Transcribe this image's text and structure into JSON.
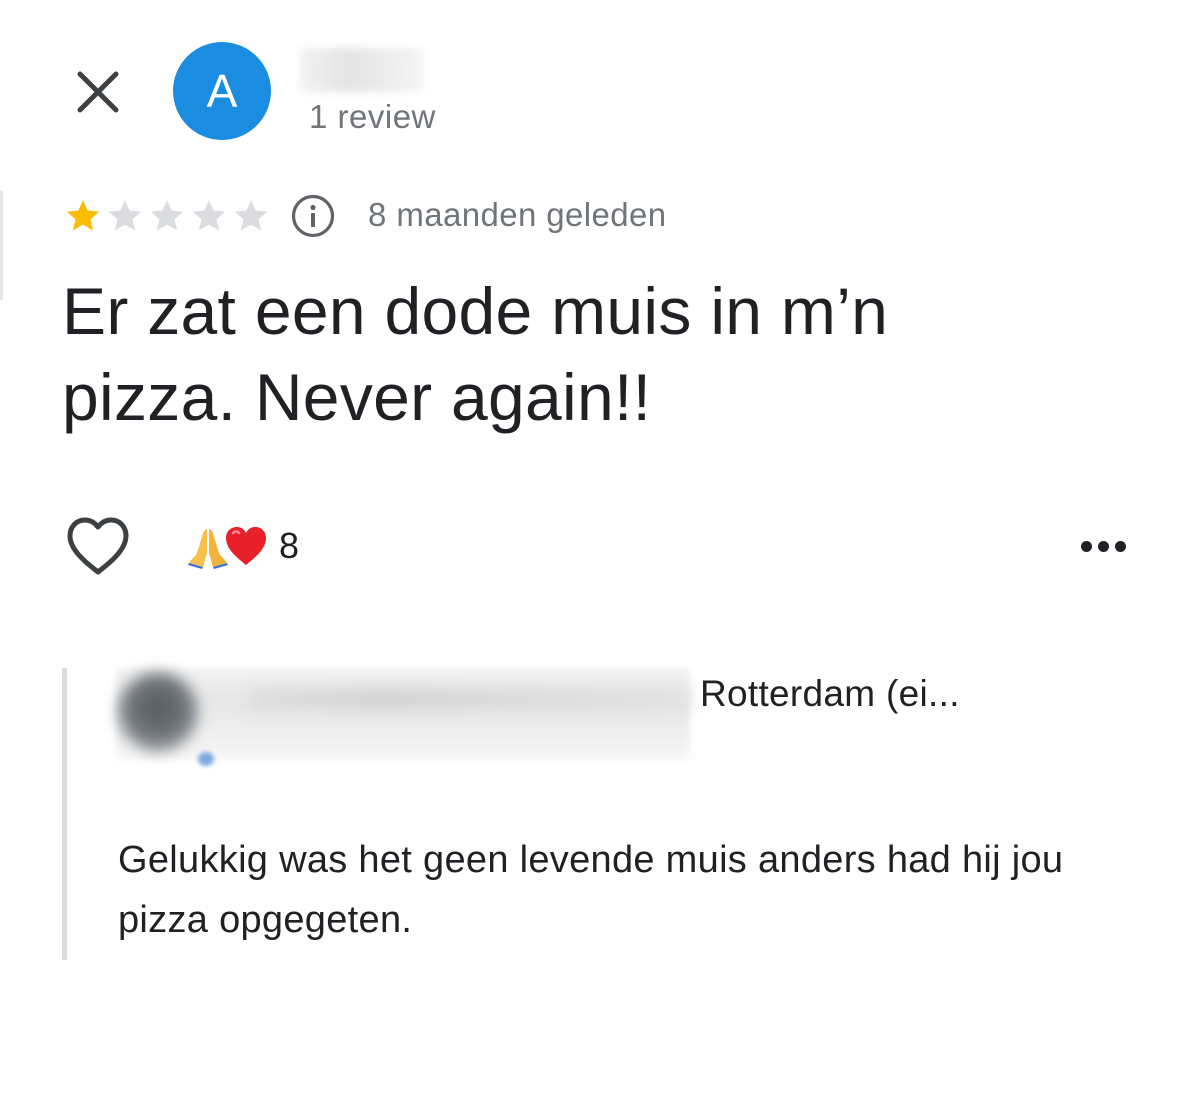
{
  "header": {
    "avatar_letter": "A",
    "avatar_color": "#1a8de0",
    "review_count": "1 review"
  },
  "rating": {
    "stars": 1,
    "max_stars": 5,
    "star_color": "#fbbc04",
    "time_ago": "8 maanden geleden"
  },
  "review": {
    "text": "Er zat een dode muis in m’n pizza. Never again!!"
  },
  "actions": {
    "reaction_emojis": [
      "folded-hands-emoji",
      "red-heart-emoji"
    ],
    "reaction_count": "8"
  },
  "reply": {
    "owner_name": "Rotterdam (ei...",
    "text": "Gelukkig was het geen levende muis anders had hij jou pizza opgegeten."
  }
}
